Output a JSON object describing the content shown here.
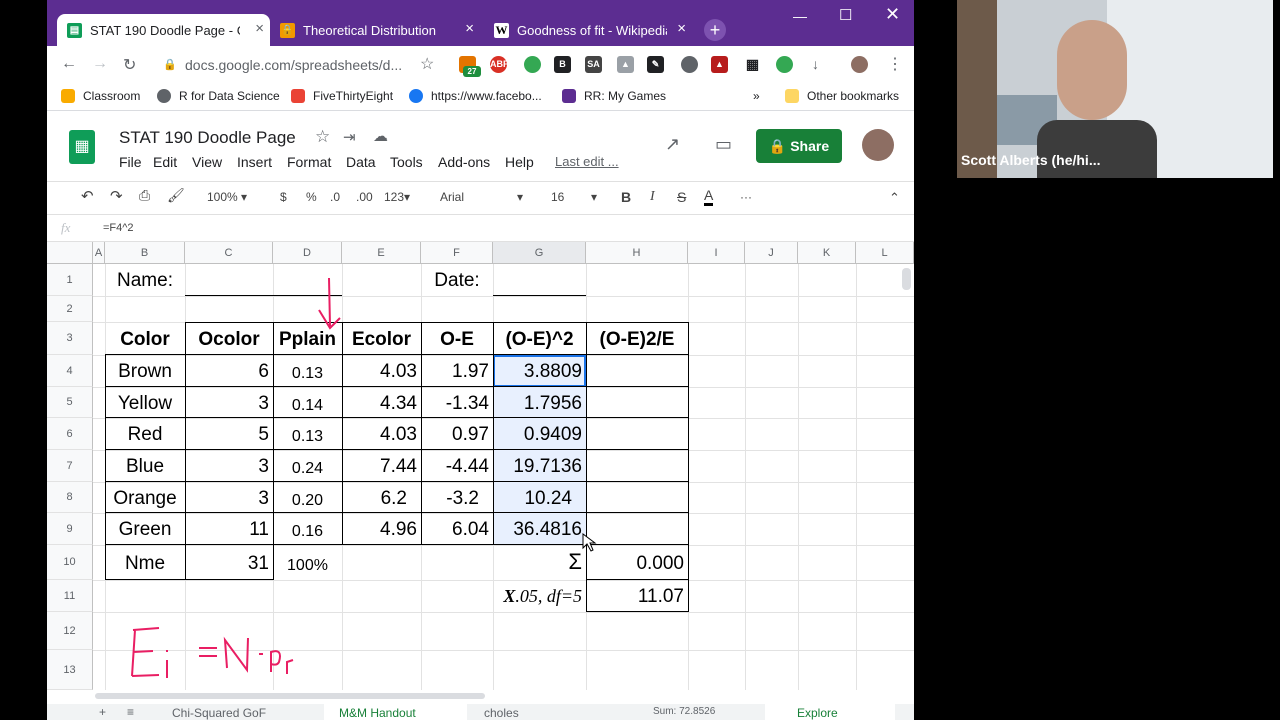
{
  "browser": {
    "tabs": [
      {
        "title": "STAT 190 Doodle Page - Go",
        "icon": "sheets-icon",
        "color": "#0f9d58"
      },
      {
        "title": "Theoretical Distribution",
        "icon": "lock-icon",
        "color": "#f29900"
      },
      {
        "title": "Goodness of fit - Wikipedia",
        "icon": "wikipedia-icon",
        "color": "#ffffff"
      }
    ],
    "new_tab": "+",
    "url": "docs.google.com/spreadsheets/d...",
    "ext_badge": "27",
    "bookmarks": [
      "Classroom",
      "R for Data Science",
      "FiveThirtyEight",
      "https://www.facebo...",
      "RR: My Games"
    ],
    "bookmark_more": "»",
    "other_bookmarks": "Other bookmarks"
  },
  "doc": {
    "title": "STAT 190 Doodle Page",
    "menus": [
      "File",
      "Edit",
      "View",
      "Insert",
      "Format",
      "Data",
      "Tools",
      "Add-ons",
      "Help"
    ],
    "last_edit": "Last edit ...",
    "share": "Share"
  },
  "toolbar": {
    "zoom": "100%",
    "currency": "$",
    "percent": "%",
    "dec_less": ".0",
    "dec_more": ".00",
    "format": "123",
    "font": "Arial",
    "size": "16",
    "bold": "B",
    "italic": "I",
    "strike": "S",
    "textcolor": "A",
    "more": "···"
  },
  "formula": {
    "fx": "fx",
    "value": "=F4^2"
  },
  "grid": {
    "columns": [
      "A",
      "B",
      "C",
      "D",
      "E",
      "F",
      "G",
      "H",
      "I",
      "J",
      "K",
      "L"
    ],
    "rows": [
      "1",
      "2",
      "3",
      "4",
      "5",
      "6",
      "7",
      "8",
      "9",
      "10",
      "11",
      "12",
      "13"
    ],
    "name_label": "Name:",
    "date_label": "Date:",
    "headers": [
      "Color",
      "Ocolor",
      "Pplain",
      "Ecolor",
      "O-E",
      "(O-E)^2",
      "(O-E)2/E"
    ],
    "data": [
      {
        "color": "Brown",
        "o": "6",
        "p": "0.13",
        "e": "4.03",
        "oe": "1.97",
        "sq": "3.8809"
      },
      {
        "color": "Yellow",
        "o": "3",
        "p": "0.14",
        "e": "4.34",
        "oe": "-1.34",
        "sq": "1.7956"
      },
      {
        "color": "Red",
        "o": "5",
        "p": "0.13",
        "e": "4.03",
        "oe": "0.97",
        "sq": "0.9409"
      },
      {
        "color": "Blue",
        "o": "3",
        "p": "0.24",
        "e": "7.44",
        "oe": "-4.44",
        "sq": "19.7136"
      },
      {
        "color": "Orange",
        "o": "3",
        "p": "0.20",
        "e": "6.2",
        "oe": "-3.2",
        "sq": "10.24"
      },
      {
        "color": "Green",
        "o": "11",
        "p": "0.16",
        "e": "4.96",
        "oe": "6.04",
        "sq": "36.4816"
      }
    ],
    "total_label": "Nme",
    "total_o": "31",
    "total_p": "100%",
    "sigma": "Σ",
    "sigma_value": "0.000",
    "chi_label_x": "X",
    "chi_label_rest": ".05, df=5",
    "chi_value": "11.07",
    "handwriting": "Ei = N·Pr"
  },
  "sheets": {
    "tabs": [
      "Chi-Squared GoF",
      "M&M Handout",
      "choles"
    ],
    "sum": "Sum: 72.8526",
    "explore": "Explore"
  },
  "webcam": {
    "name": "Scott Alberts (he/hi..."
  }
}
